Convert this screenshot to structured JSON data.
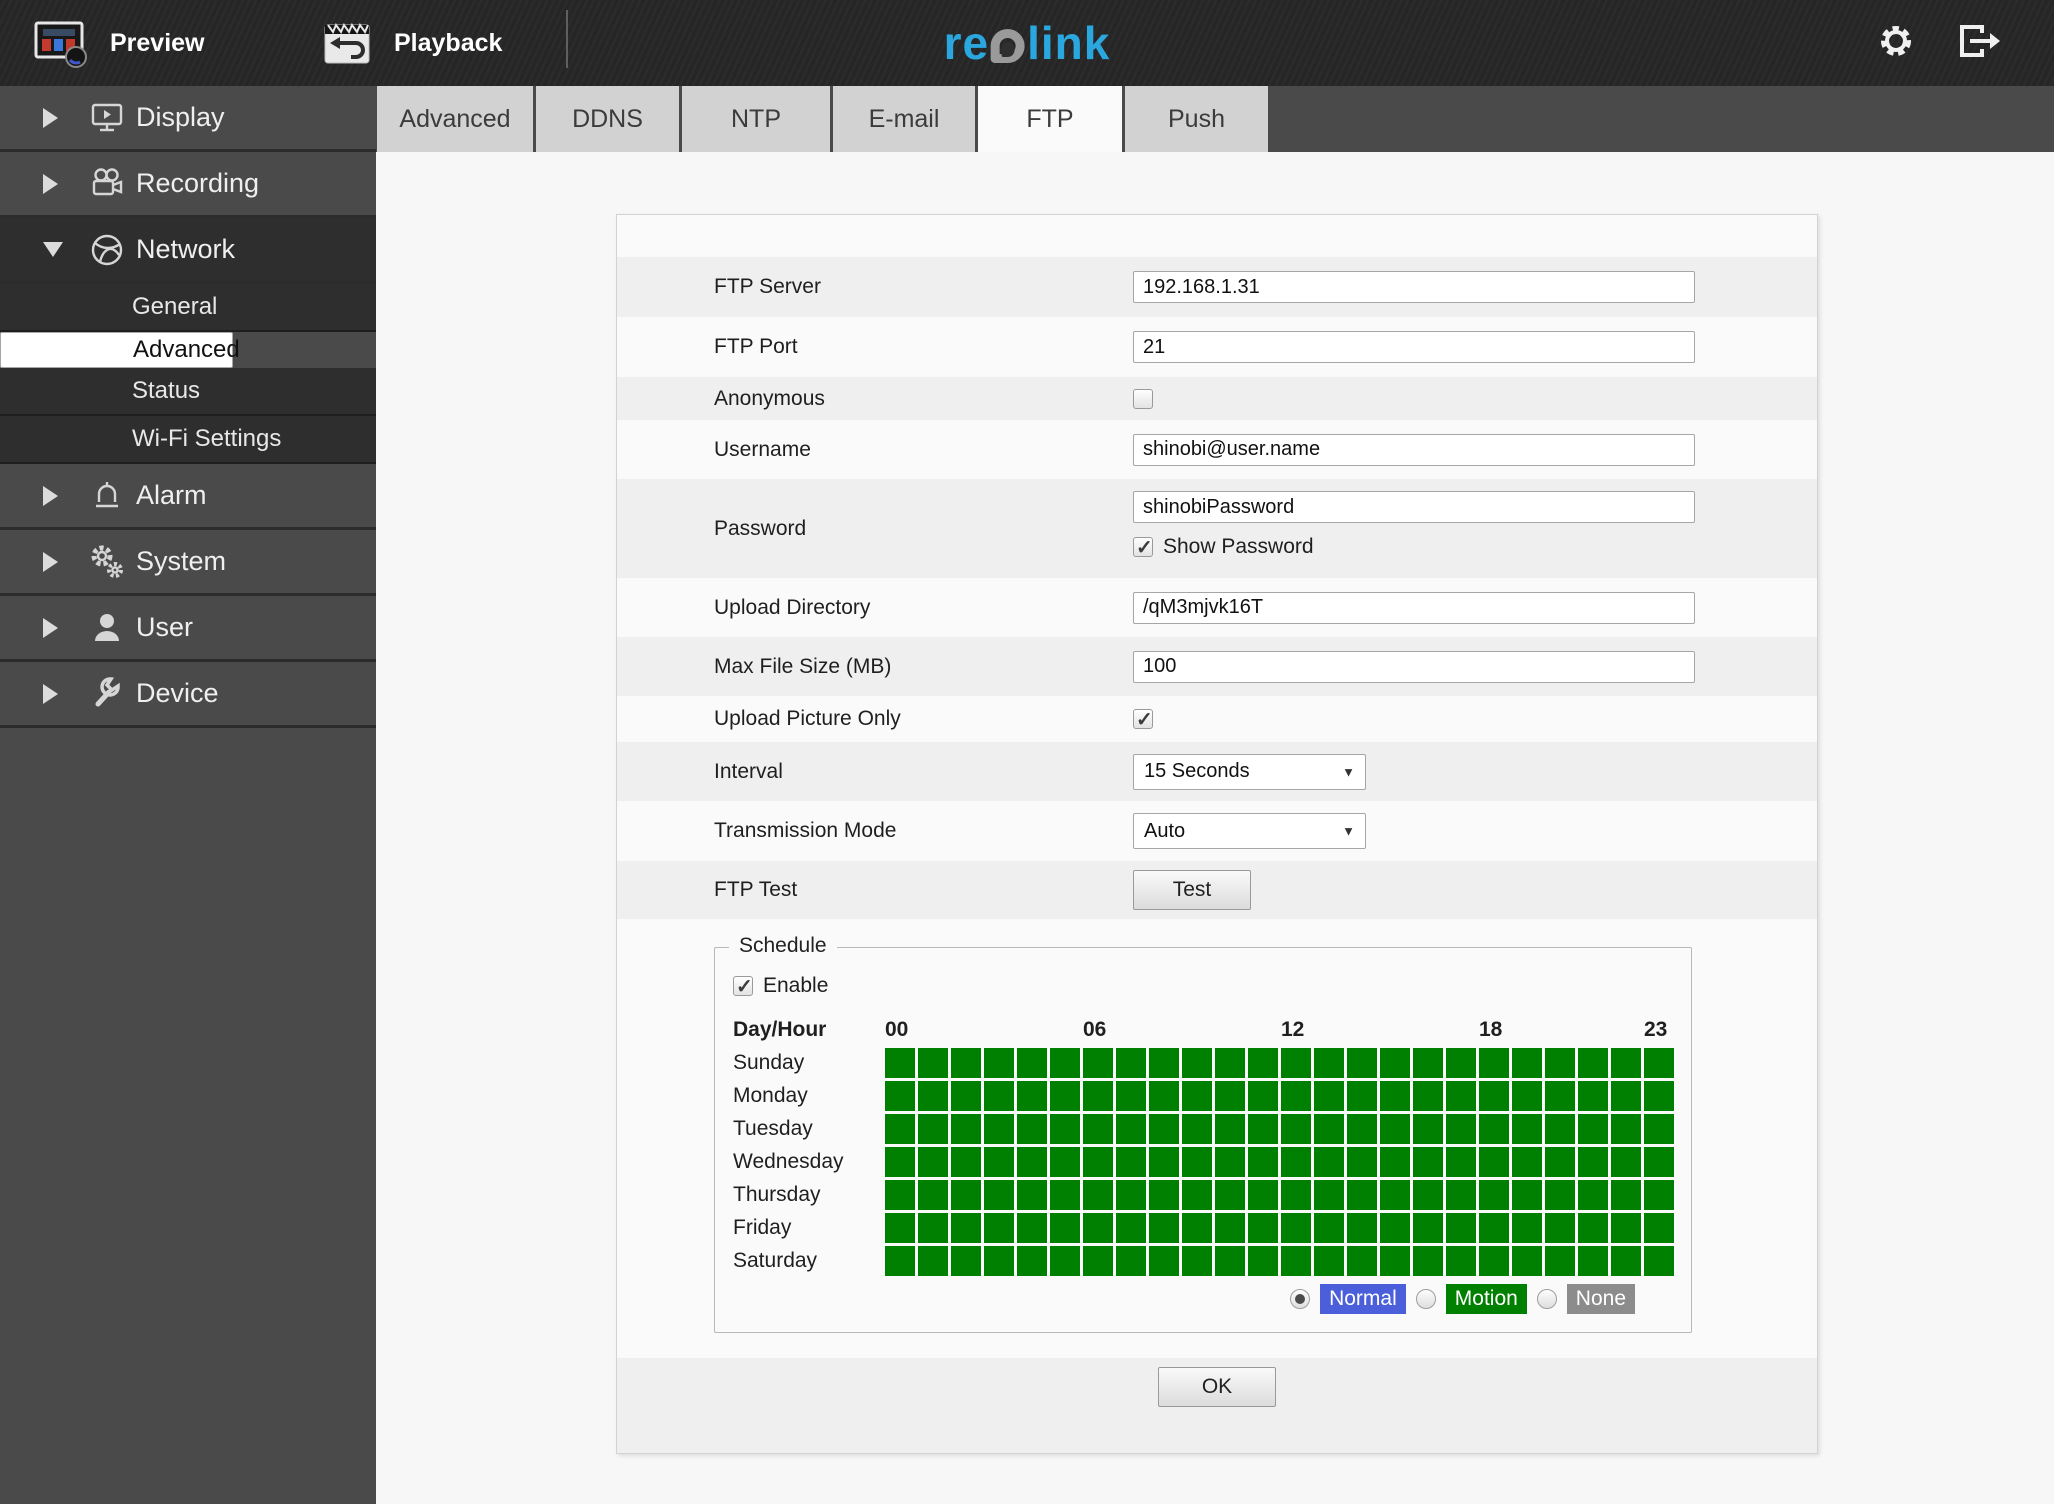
{
  "topbar": {
    "preview_label": "Preview",
    "playback_label": "Playback",
    "logo": {
      "left": "re",
      "o": "o",
      "right": "link"
    },
    "icons": [
      "preview-monitor-icon",
      "playback-clapper-icon",
      "gear-icon",
      "logout-icon"
    ]
  },
  "sidebar": {
    "items": [
      {
        "label": "Display",
        "icon": "display-monitor-icon",
        "expanded": false
      },
      {
        "label": "Recording",
        "icon": "video-camera-icon",
        "expanded": false
      },
      {
        "label": "Network",
        "icon": "network-globe-icon",
        "expanded": true,
        "children": [
          {
            "label": "General",
            "selected": false
          },
          {
            "label": "Advanced",
            "selected": true
          },
          {
            "label": "Status",
            "selected": false
          },
          {
            "label": "Wi-Fi Settings",
            "selected": false
          }
        ]
      },
      {
        "label": "Alarm",
        "icon": "alarm-siren-icon",
        "expanded": false
      },
      {
        "label": "System",
        "icon": "gears-icon",
        "expanded": false
      },
      {
        "label": "User",
        "icon": "user-icon",
        "expanded": false
      },
      {
        "label": "Device",
        "icon": "wrench-icon",
        "expanded": false
      }
    ]
  },
  "tabs": {
    "items": [
      {
        "label": "Advanced",
        "active": false
      },
      {
        "label": "DDNS",
        "active": false
      },
      {
        "label": "NTP",
        "active": false
      },
      {
        "label": "E-mail",
        "active": false
      },
      {
        "label": "FTP",
        "active": true
      },
      {
        "label": "Push",
        "active": false
      }
    ]
  },
  "form": {
    "ftp_server": {
      "label": "FTP Server",
      "value": "192.168.1.31"
    },
    "ftp_port": {
      "label": "FTP Port",
      "value": "21"
    },
    "anonymous": {
      "label": "Anonymous",
      "checked": false
    },
    "username": {
      "label": "Username",
      "value": "shinobi@user.name"
    },
    "password": {
      "label": "Password",
      "value": "shinobiPassword",
      "show_password_label": "Show Password",
      "show_password_checked": true
    },
    "upload_directory": {
      "label": "Upload Directory",
      "value": "/qM3mjvk16T"
    },
    "max_file_size": {
      "label": "Max File Size (MB)",
      "value": "100"
    },
    "upload_picture_only": {
      "label": "Upload Picture Only",
      "checked": true
    },
    "interval": {
      "label": "Interval",
      "value": "15 Seconds"
    },
    "transmission_mode": {
      "label": "Transmission Mode",
      "value": "Auto"
    },
    "ftp_test": {
      "label": "FTP Test",
      "button_label": "Test"
    }
  },
  "schedule": {
    "legend": "Schedule",
    "enable_label": "Enable",
    "enable_checked": true,
    "header_label": "Day/Hour",
    "hour_labels": [
      {
        "text": "00",
        "cell": 0
      },
      {
        "text": "06",
        "cell": 6
      },
      {
        "text": "12",
        "cell": 12
      },
      {
        "text": "18",
        "cell": 18
      },
      {
        "text": "23",
        "cell": 23
      }
    ],
    "days": [
      "Sunday",
      "Monday",
      "Tuesday",
      "Wednesday",
      "Thursday",
      "Friday",
      "Saturday"
    ],
    "hours_per_day": 24,
    "cell_color": "#008000",
    "all_cells_state": "motion",
    "modes": [
      {
        "label": "Normal",
        "color": "#4A5FD9",
        "selected": true
      },
      {
        "label": "Motion",
        "color": "#008000",
        "selected": false
      },
      {
        "label": "None",
        "color": "#8C8C8C",
        "selected": false
      }
    ]
  },
  "footer": {
    "ok_label": "OK"
  },
  "colors": {
    "logo_cyan": "#2BA7E0",
    "grid_green": "#008000",
    "normal_blue": "#4A5FD9",
    "none_gray": "#8C8C8C",
    "topbar_dark": "#262626",
    "sidebar_gray": "#4a4a4a",
    "selected_submenu": "#ffffff"
  }
}
